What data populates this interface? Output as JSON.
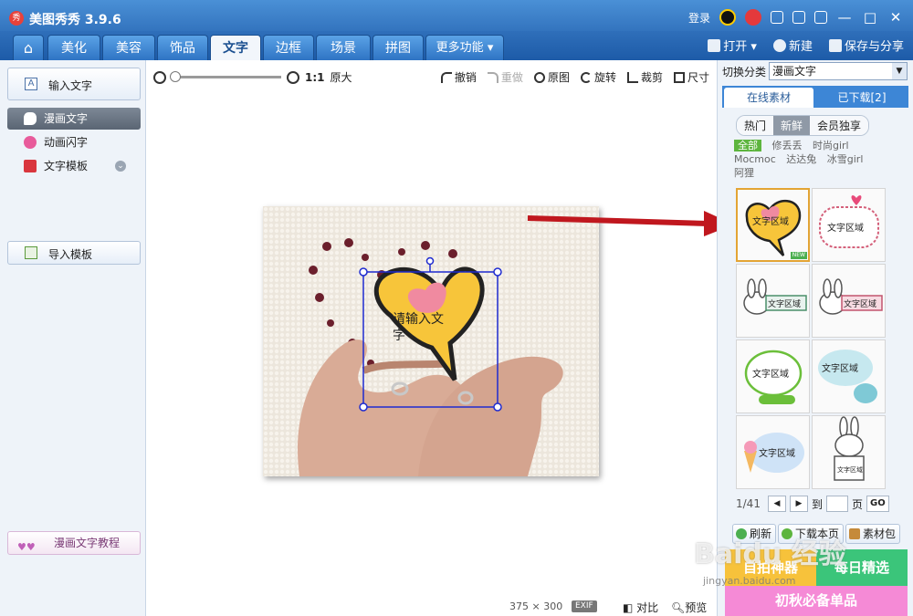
{
  "app": {
    "title": "美图秀秀 3.9.6",
    "logo": "秀"
  },
  "titlebar": {
    "login": "登录"
  },
  "tabs": [
    "美化",
    "美容",
    "饰品",
    "文字",
    "边框",
    "场景",
    "拼图",
    "更多功能"
  ],
  "tab_more_arrow": "▾",
  "file_actions": {
    "open": "打开",
    "new": "新建",
    "save": "保存与分享"
  },
  "left": {
    "input_text": "输入文字",
    "items": [
      {
        "label": "漫画文字"
      },
      {
        "label": "动画闪字"
      },
      {
        "label": "文字模板"
      }
    ],
    "import_template": "导入模板",
    "tutorial": "漫画文字教程"
  },
  "toolbar": {
    "ratio": "1:1",
    "original_size": "原大",
    "undo": "撤销",
    "redo": "重做",
    "original_image": "原图",
    "rotate": "旋转",
    "crop": "裁剪",
    "size": "尺寸"
  },
  "canvas": {
    "bubble_text": "请输入文字"
  },
  "status": {
    "width": "375",
    "sep": "×",
    "height": "300",
    "exif": "EXIF",
    "compare": "对比",
    "preview": "预览"
  },
  "right": {
    "switch_label": "切换分类",
    "category": "漫画文字",
    "tabs": [
      "在线素材",
      "已下载[2]"
    ],
    "filters": [
      "热门",
      "新鲜",
      "会员独享"
    ],
    "tags": [
      "全部",
      "修丢丢",
      "时尚girl",
      "Mocmoc",
      "达达兔",
      "冰雪girl",
      "阿狸"
    ],
    "sticker_text": "文字区域",
    "new_badge": "NEW",
    "page": "1/41",
    "goto": "到",
    "page_unit": "页",
    "go": "GO",
    "refresh": "刷新",
    "download_page": "下载本页",
    "pack": "素材包",
    "ads": [
      "自拍神器",
      "每日精选",
      "初秋必备单品"
    ]
  },
  "watermark": {
    "brand": "Baidu 经验",
    "url": "jingyan.baidu.com"
  },
  "colors": {
    "accent": "#2f6fba",
    "selection": "#1e2bd0",
    "arrow": "#c0171e"
  }
}
